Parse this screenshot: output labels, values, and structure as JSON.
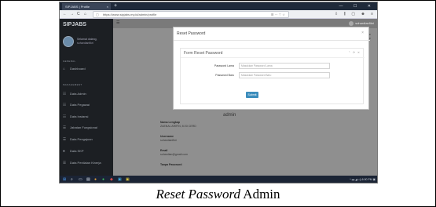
{
  "browser": {
    "tab_title": "SIPJABS | Profile",
    "tab_close": "×",
    "new_tab": "+",
    "window_controls": "— ☐ ✕",
    "nav": {
      "back": "←",
      "forward": "→",
      "reload": "C",
      "home": "⌂"
    },
    "url": "https://www.sipjabs.my.id/admin/profile",
    "url_actions": "☰ ··· ♡ ☆",
    "toolbar_right": "⇩ ⫼ ▢ ☻ ≡"
  },
  "app": {
    "brand": "SIPJABS",
    "user_name": "Selamat datang,",
    "user_sub": "sohardianfikri",
    "section_general": "GENERAL",
    "section_management": "MANAGEMENT",
    "sidebar_items": [
      {
        "label": "Dashboard",
        "icon": "home-icon",
        "glyph": "⌂"
      },
      {
        "label": "Data Admin",
        "icon": "users-icon",
        "glyph": "☷"
      },
      {
        "label": "Data Pegawai",
        "icon": "user-icon",
        "glyph": "☷"
      },
      {
        "label": "Data Instansi",
        "icon": "building-icon",
        "glyph": "☷"
      },
      {
        "label": "Jabatan Fungsional",
        "icon": "list-icon",
        "glyph": "☰"
      },
      {
        "label": "Data Pengajuan",
        "icon": "file-icon",
        "glyph": "☰"
      },
      {
        "label": "Data SKP",
        "icon": "clipboard-icon",
        "glyph": "●"
      },
      {
        "label": "Data Penilaian Kinerja",
        "icon": "chart-icon",
        "glyph": "☰"
      }
    ],
    "account": "sohardianfikri",
    "breadcrumb_1": "Home",
    "breadcrumb_2": "/ Profile",
    "profile_title": "admin",
    "profile_fields": [
      {
        "label": "Nama Lengkap",
        "value": "ZAENAL ARIFIN, M.SI CERD"
      },
      {
        "label": "Username",
        "value": "sohardianfikri"
      },
      {
        "label": "Email",
        "value": "sohardian@gmail.com"
      },
      {
        "label": "Tanpa Password",
        "value": ""
      }
    ]
  },
  "modal": {
    "title": "Reset Password",
    "close": "×",
    "panel_title": "Form Reset Password",
    "panel_tools": "⌃ ⟳ ✕",
    "old_label": "Password Lama",
    "old_placeholder": "Masukkan Password Lama",
    "new_label": "Password Baru",
    "new_placeholder": "Masukkan Password Baru",
    "submit": "Submit"
  },
  "taskbar": {
    "items": [
      "⊞",
      "⌕",
      "▭",
      "▤",
      "●",
      "●",
      "◆",
      "▣",
      "▣"
    ],
    "system": "^ ▬ ◢ ◁) 6:00 PM ▣"
  },
  "caption": {
    "italic": "Reset Password",
    "rest": " Admin"
  }
}
